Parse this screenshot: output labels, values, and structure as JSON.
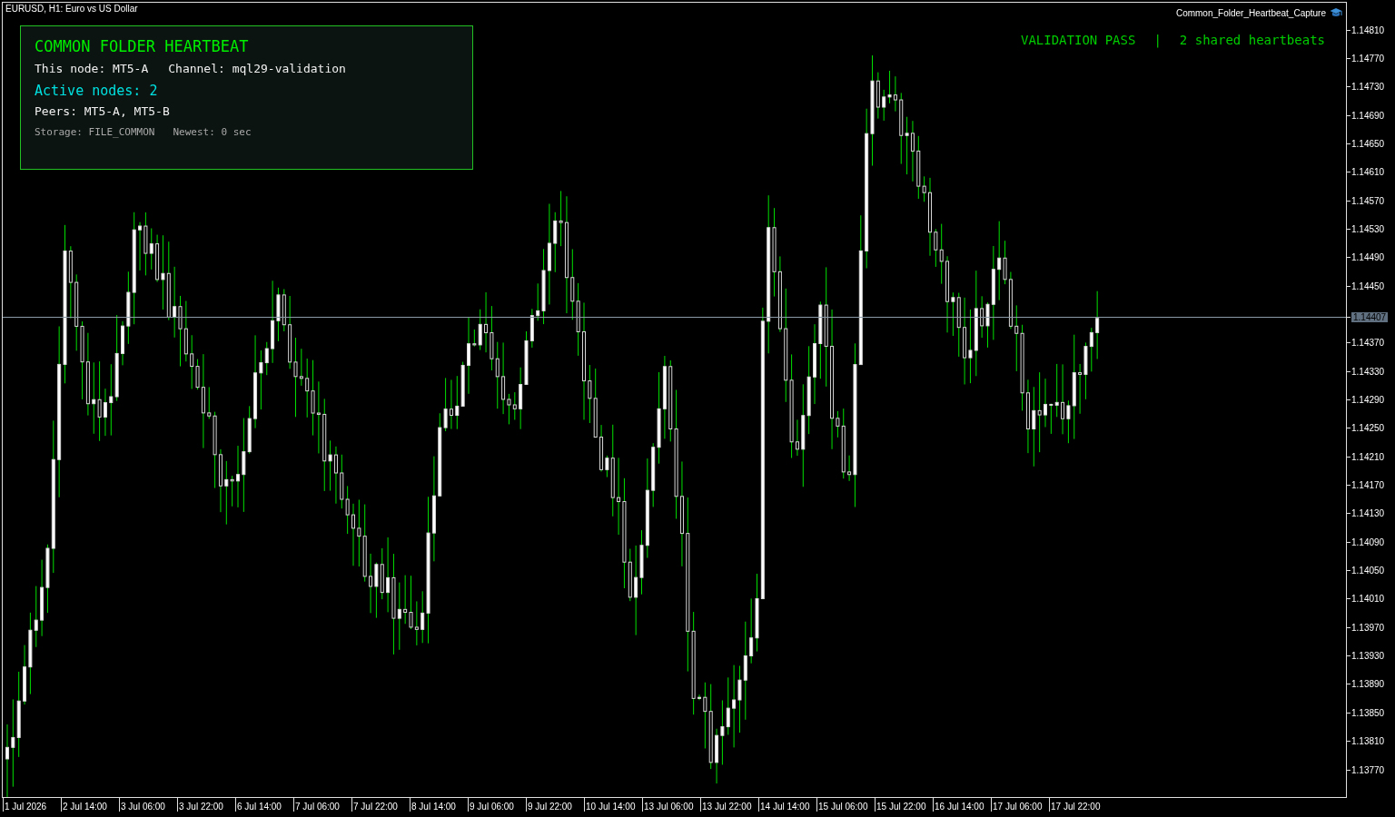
{
  "chart_title": "EURUSD, H1:  Euro vs US Dollar",
  "script_name": "Common_Folder_Heartbeat_Capture",
  "status": {
    "result": "VALIDATION PASS",
    "separator": "|",
    "summary": "2 shared heartbeats"
  },
  "panel": {
    "title": "COMMON FOLDER HEARTBEAT",
    "node": "This node: MT5-A",
    "channel": "Channel: mql29-validation",
    "active_nodes": "Active nodes: 2",
    "peers": "Peers: MT5-A, MT5-B",
    "storage": "Storage: FILE_COMMON",
    "newest": "Newest: 0 sec"
  },
  "price_axis": {
    "labels": [
      "1.14810",
      "1.14770",
      "1.14730",
      "1.14690",
      "1.14650",
      "1.14610",
      "1.14570",
      "1.14530",
      "1.14490",
      "1.14450",
      "1.14370",
      "1.14330",
      "1.14290",
      "1.14250",
      "1.14210",
      "1.14170",
      "1.14130",
      "1.14090",
      "1.14050",
      "1.14010",
      "1.13970",
      "1.13930",
      "1.13890",
      "1.13850",
      "1.13810",
      "1.13770"
    ],
    "current_price": "1.14407"
  },
  "time_axis": {
    "labels": [
      "1 Jul 2026",
      "2 Jul 14:00",
      "3 Jul 06:00",
      "3 Jul 22:00",
      "6 Jul 14:00",
      "7 Jul 06:00",
      "7 Jul 22:00",
      "8 Jul 14:00",
      "9 Jul 06:00",
      "9 Jul 22:00",
      "10 Jul 14:00",
      "13 Jul 06:00",
      "13 Jul 22:00",
      "14 Jul 14:00",
      "15 Jul 06:00",
      "15 Jul 22:00",
      "16 Jul 14:00",
      "17 Jul 06:00",
      "17 Jul 22:00"
    ]
  }
}
